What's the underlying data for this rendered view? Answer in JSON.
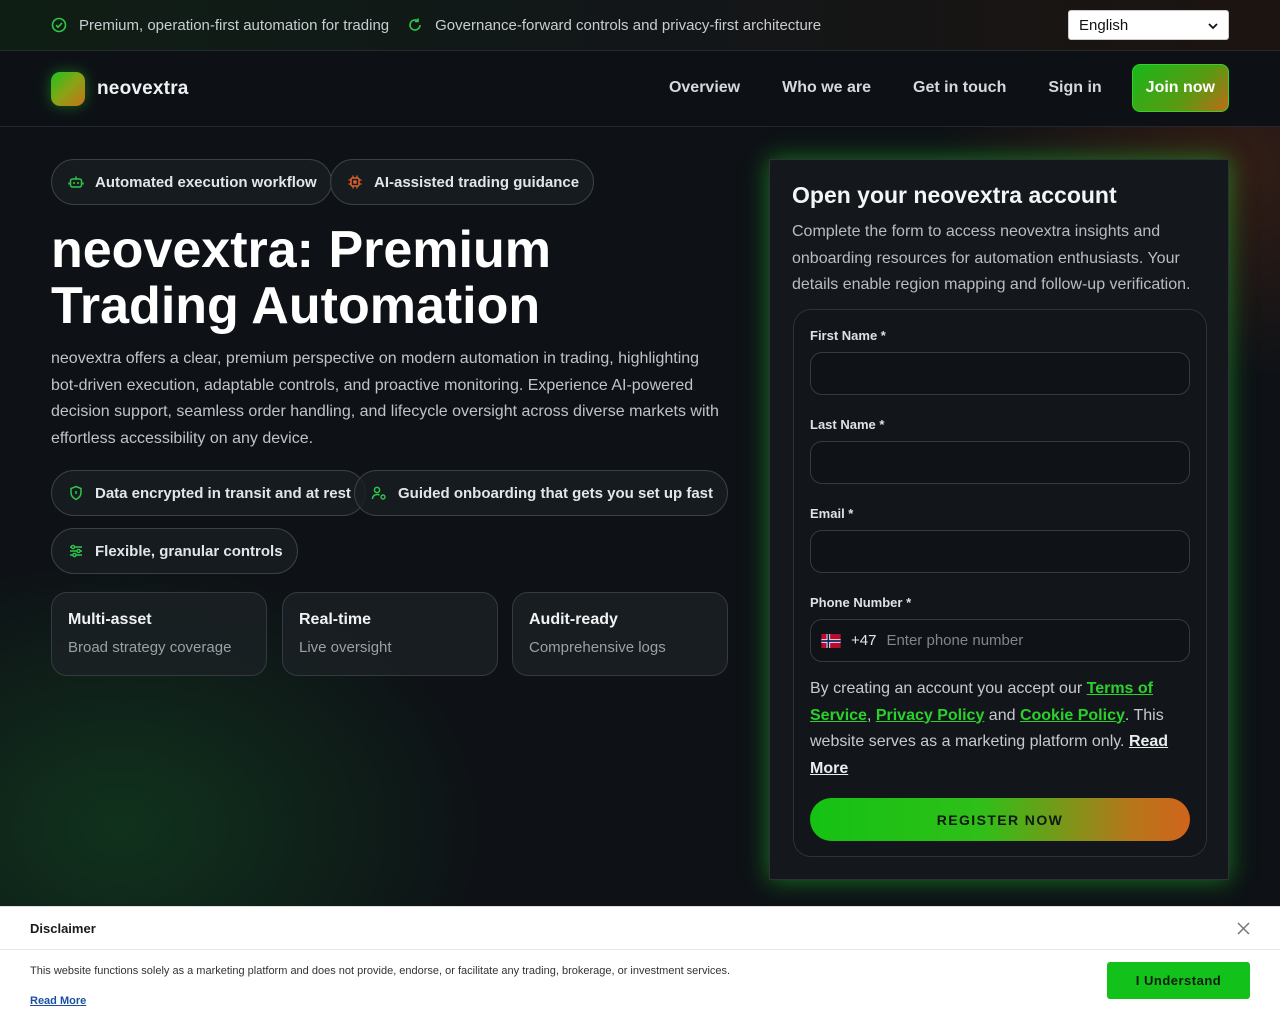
{
  "topbar": {
    "note1": "Premium, operation-first automation for trading",
    "note2": "Governance-forward controls and privacy-first architecture",
    "language": "English"
  },
  "nav": {
    "brand": "neovextra",
    "links": [
      "Overview",
      "Who we are",
      "Get in touch",
      "Sign in"
    ],
    "join": "Join now"
  },
  "hero": {
    "pill1": "Automated execution workflow",
    "pill2": "AI-assisted trading guidance",
    "title": "neovextra: Premium Trading Automation",
    "lead": "neovextra offers a clear, premium perspective on modern automation in trading, highlighting bot-driven execution, adaptable controls, and proactive monitoring. Experience AI-powered decision support, seamless order handling, and lifecycle oversight across diverse markets with effortless accessibility on any device.",
    "badges": [
      "Data encrypted in transit and at rest",
      "Guided onboarding that gets you set up fast",
      "Flexible, granular controls"
    ],
    "stats": [
      {
        "title": "Multi-asset",
        "sub": "Broad strategy coverage"
      },
      {
        "title": "Real-time",
        "sub": "Live oversight"
      },
      {
        "title": "Audit-ready",
        "sub": "Comprehensive logs"
      }
    ]
  },
  "form": {
    "title": "Open your neovextra account",
    "desc": "Complete the form to access neovextra insights and onboarding resources for automation enthusiasts. Your details enable region mapping and follow-up verification.",
    "first_name": "First Name *",
    "last_name": "Last Name *",
    "email": "Email *",
    "phone": "Phone Number *",
    "phone_code": "+47",
    "phone_placeholder": "Enter phone number",
    "legal_1": "By creating an account you accept our ",
    "terms": "Terms of Service",
    "comma": ", ",
    "privacy": "Privacy Policy",
    "and": " and ",
    "cookie": "Cookie Policy",
    "legal_2": ". This website serves as a marketing platform only. ",
    "read_more": "Read More",
    "submit": "REGISTER NOW"
  },
  "disclaimer": {
    "title": "Disclaimer",
    "text": "This website functions solely as a marketing platform and does not provide, endorse, or facilitate any trading, brokerage, or investment services.",
    "read_more": "Read More",
    "button": "I Understand"
  },
  "colors": {
    "accent_green": "#18b81a",
    "accent_orange": "#c7711a",
    "background": "#0d1117"
  }
}
